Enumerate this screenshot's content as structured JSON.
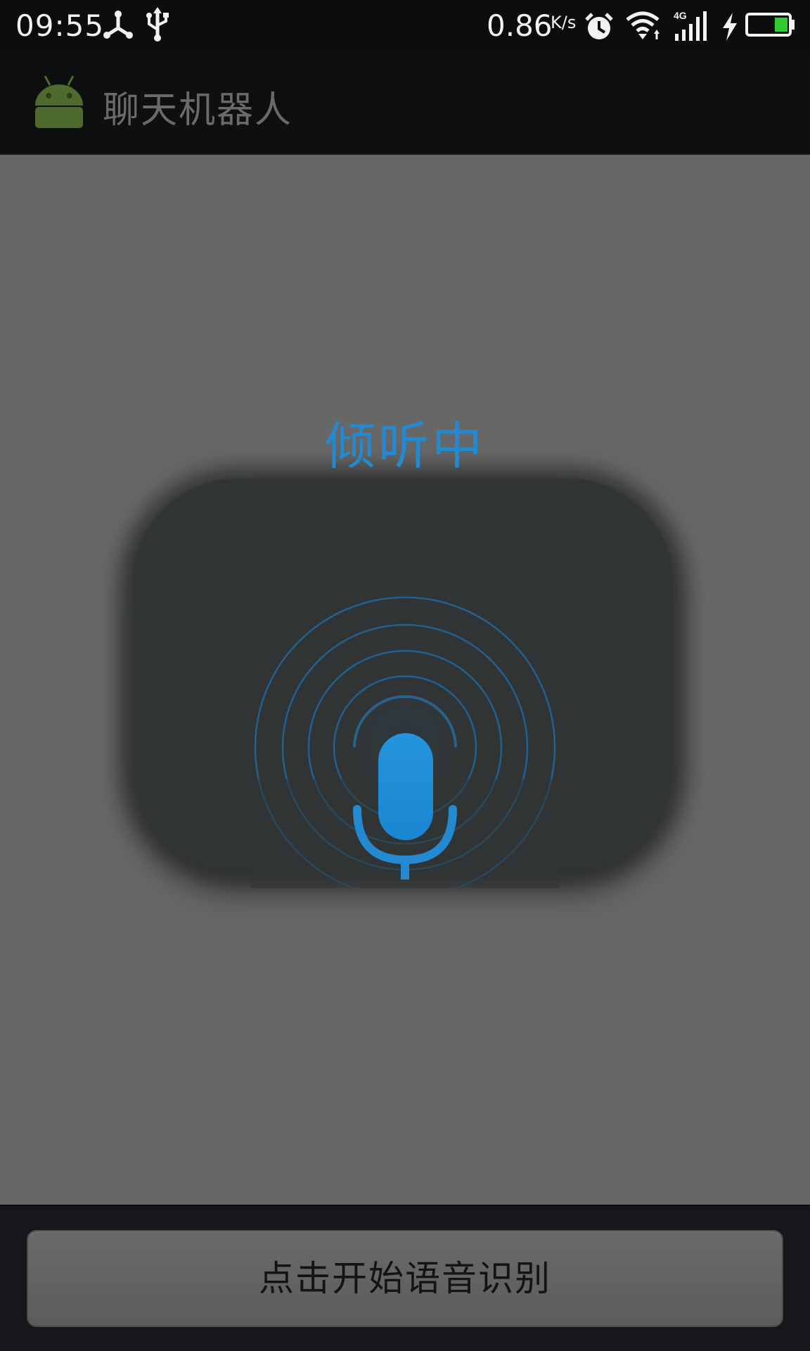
{
  "status_bar": {
    "time": "09:55",
    "network_speed": "0.86",
    "network_speed_unit": "K/s",
    "network_type": "4G",
    "left_icons": [
      "hotspot-icon",
      "usb-icon"
    ],
    "right_icons": [
      "alarm-icon",
      "wifi-icon",
      "signal-icon",
      "charging-icon",
      "battery-icon"
    ]
  },
  "action_bar": {
    "title": "聊天机器人",
    "logo_icon": "android-logo-icon"
  },
  "voice_dialog": {
    "title": "倾听中",
    "mic_icon": "microphone-icon",
    "accent_color": "#2389d0"
  },
  "bottom_bar": {
    "button_label": "点击开始语音识别"
  }
}
